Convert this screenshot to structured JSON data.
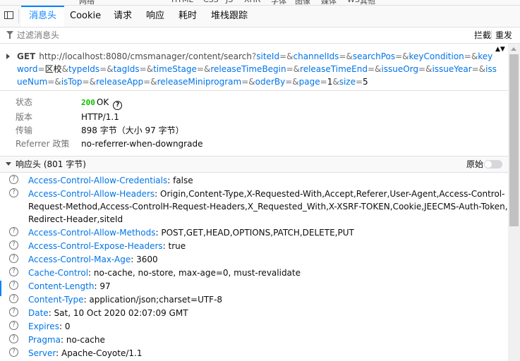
{
  "toolbar_top": [
    "网络",
    "HTML",
    "CSS",
    "JS",
    "XHR",
    "字体",
    "图像",
    "媒体",
    "WS",
    "其他"
  ],
  "tabs": [
    {
      "label": "消息头",
      "active": true
    },
    {
      "label": "Cookie",
      "active": false
    },
    {
      "label": "请求",
      "active": false
    },
    {
      "label": "响应",
      "active": false
    },
    {
      "label": "耗时",
      "active": false
    },
    {
      "label": "堆栈跟踪",
      "active": false
    }
  ],
  "filter": {
    "placeholder": "过滤消息头",
    "block_label": "拦截",
    "resend_label": "重发"
  },
  "request": {
    "method": "GET",
    "base": "http://localhost:8080/cmsmanager/content/search",
    "params": [
      {
        "k": "siteId",
        "v": ""
      },
      {
        "k": "channelIds",
        "v": ""
      },
      {
        "k": "searchPos",
        "v": ""
      },
      {
        "k": "keyCondition",
        "v": ""
      },
      {
        "k": "keyword",
        "v": "区校"
      },
      {
        "k": "typeIds",
        "v": ""
      },
      {
        "k": "tagIds",
        "v": ""
      },
      {
        "k": "timeStage",
        "v": ""
      },
      {
        "k": "releaseTimeBegin",
        "v": ""
      },
      {
        "k": "releaseTimeEnd",
        "v": ""
      },
      {
        "k": "issueOrg",
        "v": ""
      },
      {
        "k": "issueYear",
        "v": ""
      },
      {
        "k": "issueNum",
        "v": ""
      },
      {
        "k": "isTop",
        "v": ""
      },
      {
        "k": "releaseApp",
        "v": ""
      },
      {
        "k": "releaseMiniprogram",
        "v": ""
      },
      {
        "k": "oderBy",
        "v": ""
      },
      {
        "k": "page",
        "v": "1"
      },
      {
        "k": "size",
        "v": "5"
      }
    ]
  },
  "summary": {
    "status_label": "状态",
    "status_code": "200",
    "status_text": "OK",
    "version_label": "版本",
    "version": "HTTP/1.1",
    "transfer_label": "传输",
    "transfer": "898 字节（大小 97 字节）",
    "referrer_label": "Referrer 政策",
    "referrer": "no-referrer-when-downgrade"
  },
  "response_section": {
    "title": "响应头 (801 字节)",
    "raw_label": "原始"
  },
  "headers": [
    {
      "name": "Access-Control-Allow-Credentials",
      "value": "false"
    },
    {
      "name": "Access-Control-Allow-Headers",
      "value": "Origin,Content-Type,X-Requested-With,Accept,Referer,User-Agent,Access-Control-Request-Method,Access-ControlH-Request-Headers,X_Requested_With,X-XSRF-TOKEN,Cookie,JEECMS-Auth-Token,Redirect-Header,siteId"
    },
    {
      "name": "Access-Control-Allow-Methods",
      "value": "POST,GET,HEAD,OPTIONS,PATCH,DELETE,PUT"
    },
    {
      "name": "Access-Control-Expose-Headers",
      "value": "true"
    },
    {
      "name": "Access-Control-Max-Age",
      "value": "3600"
    },
    {
      "name": "Cache-Control",
      "value": "no-cache, no-store, max-age=0, must-revalidate"
    },
    {
      "name": "Content-Length",
      "value": "97"
    },
    {
      "name": "Content-Type",
      "value": "application/json;charset=UTF-8"
    },
    {
      "name": "Date",
      "value": "Sat, 10 Oct 2020 02:07:09 GMT"
    },
    {
      "name": "Expires",
      "value": "0"
    },
    {
      "name": "Pragma",
      "value": "no-cache"
    },
    {
      "name": "Server",
      "value": "Apache-Coyote/1.1"
    }
  ]
}
